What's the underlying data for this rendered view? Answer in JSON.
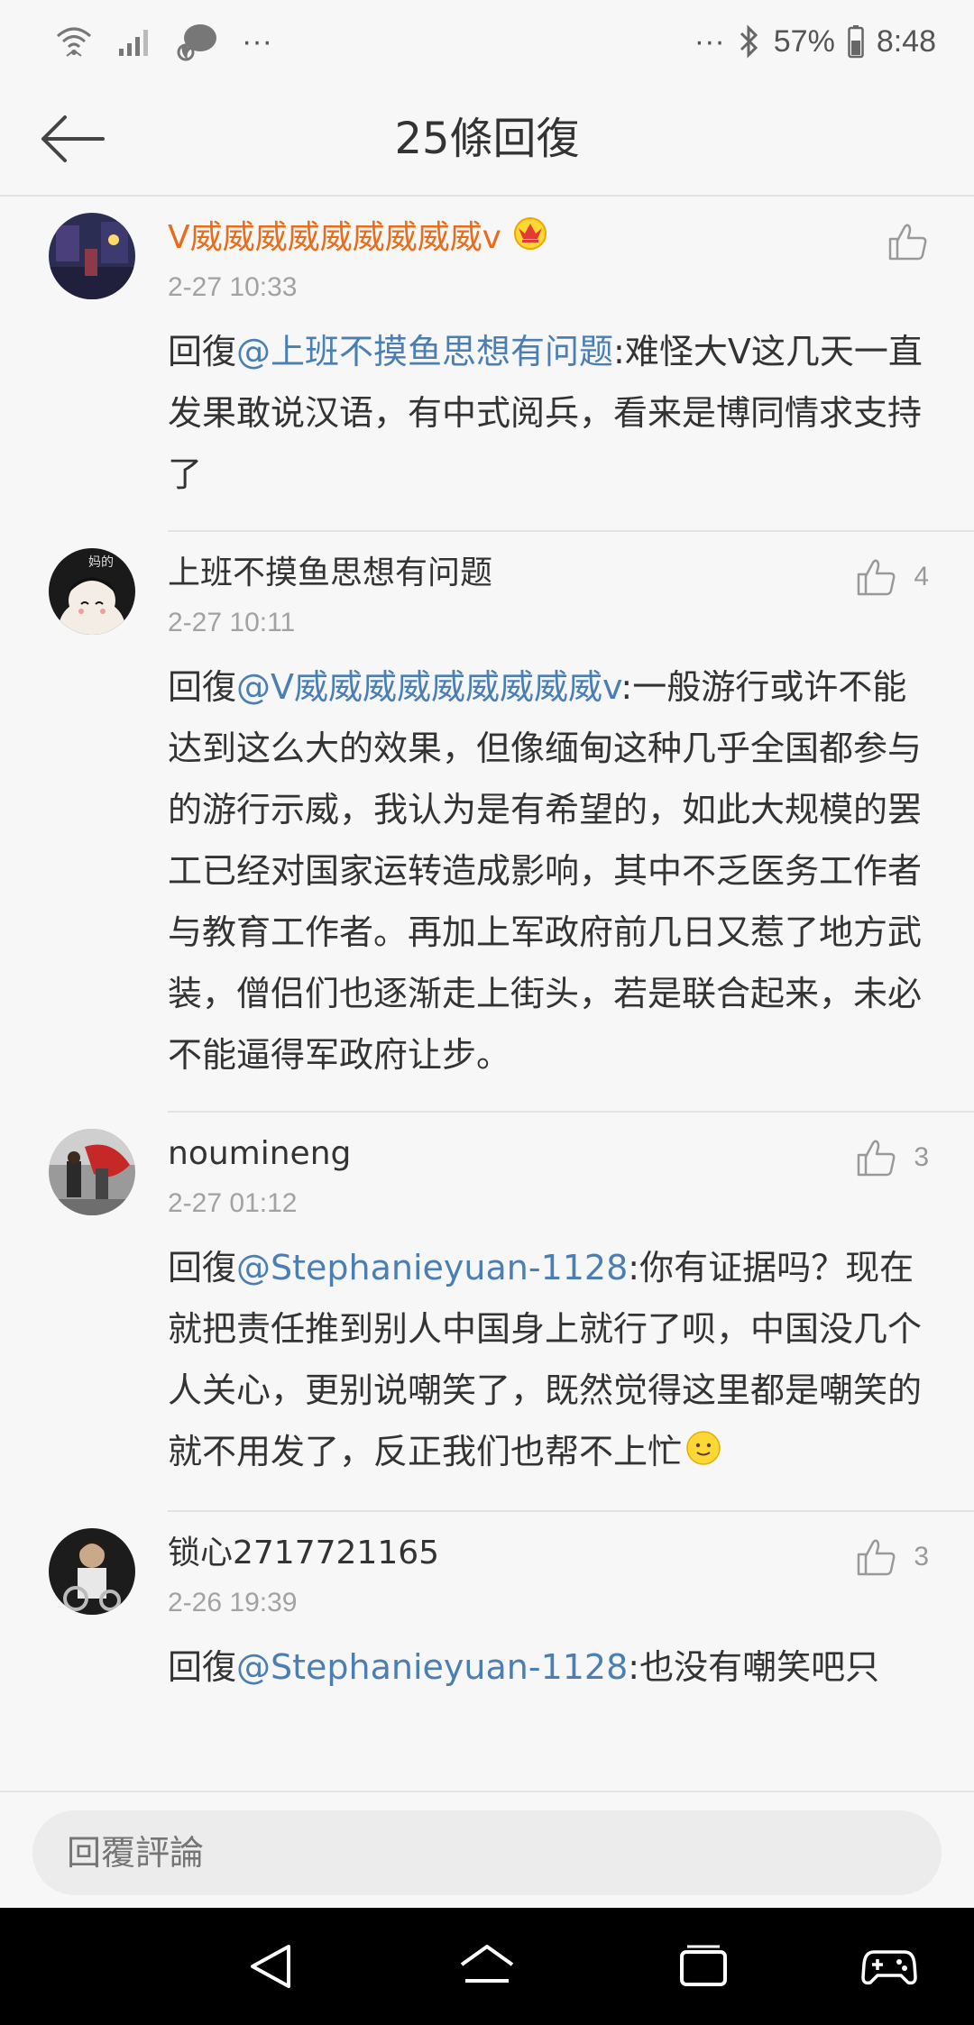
{
  "status_bar": {
    "left_icons": [
      "wifi-icon",
      "signal-icon",
      "chat-bubble-icon",
      "more-dots-icon"
    ],
    "right_dots": "···",
    "battery_percent": "57%",
    "time": "8:48"
  },
  "title_bar": {
    "title": "25條回復"
  },
  "comments": [
    {
      "name": "V威威威威威威威威威v",
      "vip": true,
      "time": "2-27 10:33",
      "reply_prefix": "回復",
      "mention": "@上班不摸鱼思想有问题",
      "text": ":难怪大V这几天一直发果敢说汉语，有中式阅兵，看来是博同情求支持了",
      "like_count": ""
    },
    {
      "name": "上班不摸鱼思想有问题",
      "vip": false,
      "time": "2-27 10:11",
      "reply_prefix": "回復",
      "mention": "@V威威威威威威威威威v",
      "text": ":一般游行或许不能达到这么大的效果，但像缅甸这种几乎全国都参与的游行示威，我认为是有希望的，如此大规模的罢工已经对国家运转造成影响，其中不乏医务工作者与教育工作者。再加上军政府前几日又惹了地方武装，僧侣们也逐渐走上街头，若是联合起来，未必不能逼得军政府让步。",
      "like_count": "4"
    },
    {
      "name": "noumineng",
      "vip": false,
      "time": "2-27 01:12",
      "reply_prefix": "回復",
      "mention": "@Stephanieyuan-1128",
      "text": ":你有证据吗？现在就把责任推到别人中国身上就行了呗，中国没几个人关心，更别说嘲笑了，既然觉得这里都是嘲笑的就不用发了，反正我们也帮不上忙",
      "like_count": "3"
    },
    {
      "name": "锁心2717721165",
      "vip": false,
      "time": "2-26 19:39",
      "reply_prefix": "回復",
      "mention": "@Stephanieyuan-1128",
      "text": ":也没有嘲笑吧只",
      "like_count": "3"
    }
  ],
  "reply_bar": {
    "placeholder": "回覆評論"
  },
  "colors": {
    "background": "#f7f7f7",
    "vip_name": "#e86c1a",
    "mention": "#4b7fb3",
    "timestamp": "#a2a2a2"
  }
}
